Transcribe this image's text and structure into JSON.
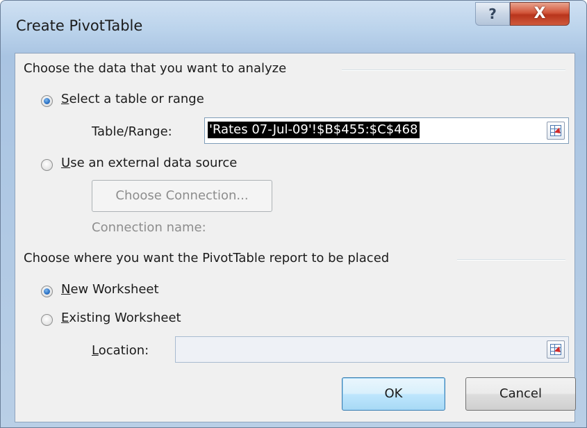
{
  "window": {
    "title": "Create PivotTable",
    "help_glyph": "?",
    "close_glyph": "X"
  },
  "analyze_section": {
    "heading": "Choose the data that you want to analyze",
    "option_table_range": {
      "access_key": "S",
      "label_rest": "elect a table or range",
      "selected": true
    },
    "table_range": {
      "label": "Table/Range:",
      "value": "'Rates 07-Jul-09'!$B$455:$C$468"
    },
    "option_external": {
      "access_key": "U",
      "label_rest": "se an external data source",
      "selected": false
    },
    "choose_connection_label": "Choose Connection...",
    "connection_name_label": "Connection name:"
  },
  "placement_section": {
    "heading": "Choose where you want the PivotTable report to be placed",
    "option_new": {
      "access_key": "N",
      "label_rest": "ew Worksheet",
      "selected": true
    },
    "option_existing": {
      "access_key": "E",
      "label_rest": "xisting Worksheet",
      "selected": false
    },
    "location": {
      "access_key": "L",
      "label_rest": "ocation:",
      "value": ""
    }
  },
  "buttons": {
    "ok": "OK",
    "cancel": "Cancel"
  },
  "icons": {
    "range_picker": "collapse-dialog-icon",
    "help": "help-icon",
    "close": "close-icon"
  },
  "colors": {
    "title_bar": "#bcd4ec",
    "close_button": "#c8452a",
    "client_background": "#f0f0f0",
    "selection_highlight": "#000000",
    "radio_selected": "#2a70c4"
  }
}
